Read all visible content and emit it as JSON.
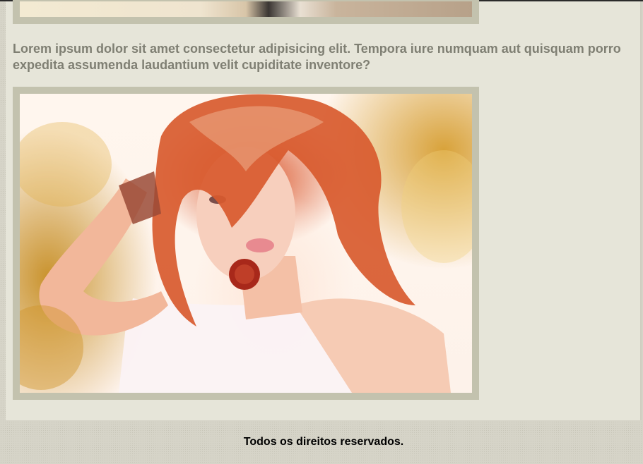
{
  "article": {
    "caption": "Lorem ipsum dolor sit amet consectetur adipisicing elit. Tempora iure numquam aut quisquam porro expedita assumenda laudantium velit cupiditate inventore?"
  },
  "footer": {
    "text": "Todos os direitos reservados."
  },
  "colors": {
    "page_background": "#d6d4c8",
    "content_background": "#e6e5d9",
    "frame": "#c3c2ae",
    "caption_text": "#7f7f73"
  }
}
